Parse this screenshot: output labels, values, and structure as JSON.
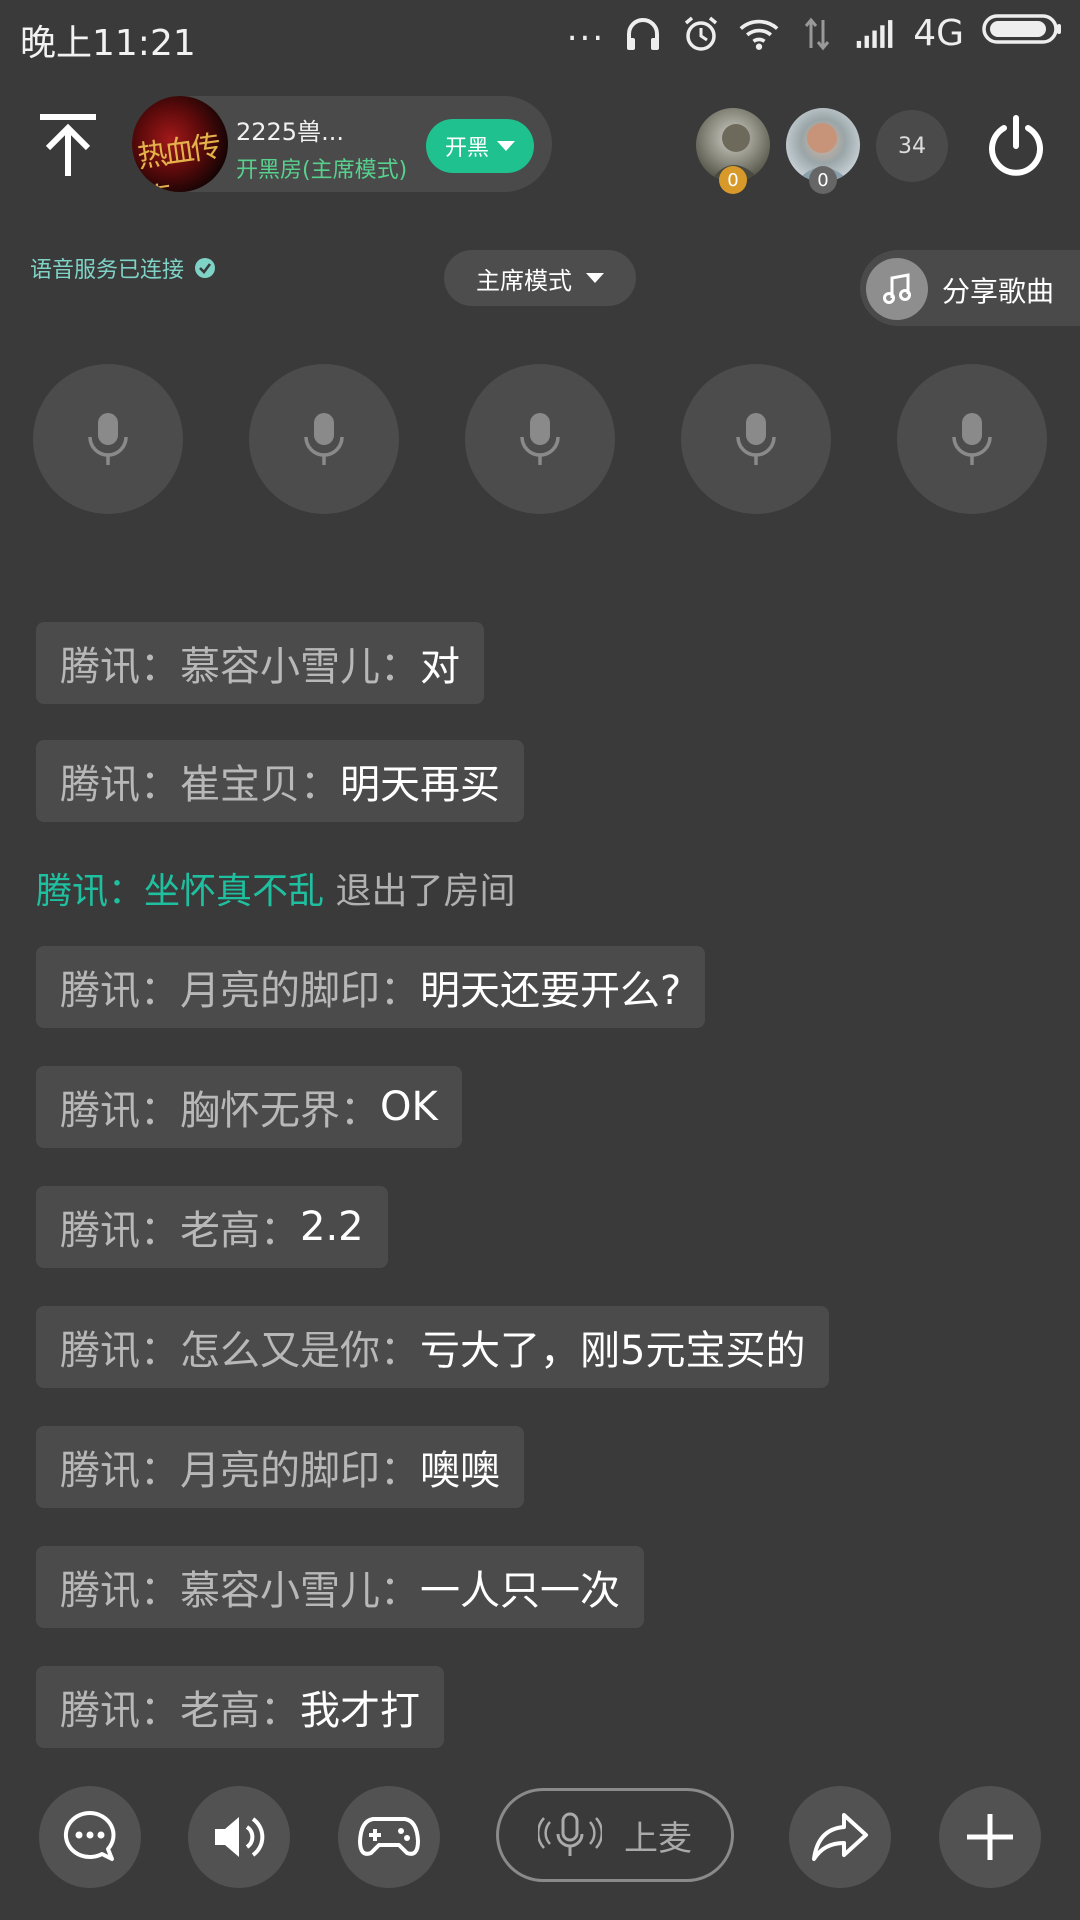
{
  "status_bar": {
    "time": "晚上11:21",
    "more": "...",
    "network": "4G"
  },
  "room": {
    "name": "2225兽...",
    "mode_text": "开黑房(主席模式)",
    "kaihei_label": "开黑",
    "users": [
      {
        "badge": "0",
        "badge_color": "#d79a2a"
      },
      {
        "badge": "0",
        "badge_color": "#666666"
      }
    ],
    "member_count": "34"
  },
  "voice_status": "语音服务已连接",
  "mode_dropdown": "主席模式",
  "share_song_label": "分享歌曲",
  "mic_slots": 5,
  "chat": [
    {
      "prefix": "腾讯：慕容小雪儿：",
      "msg": "对"
    },
    {
      "prefix": "腾讯：崔宝贝：",
      "msg": "明天再买"
    },
    {
      "prefix": "腾讯：月亮的脚印：",
      "msg": "明天还要开么?"
    },
    {
      "prefix": "腾讯：胸怀无界：",
      "msg": "OK"
    },
    {
      "prefix": "腾讯：老高：",
      "msg": "2.2"
    },
    {
      "prefix": "腾讯：怎么又是你：",
      "msg": "亏大了，刚5元宝买的"
    },
    {
      "prefix": "腾讯：月亮的脚印：",
      "msg": "噢噢"
    },
    {
      "prefix": "腾讯：慕容小雪儿：",
      "msg": "一人只一次"
    },
    {
      "prefix": "腾讯：老高：",
      "msg": "我才打"
    }
  ],
  "system_message": {
    "name": "腾讯：坐怀真不乱",
    "text": " 退出了房间"
  },
  "bottom_bar": {
    "mic_up_label": "上麦"
  },
  "colors": {
    "background": "#3a3a3a",
    "accent_green": "#1fc28f",
    "system_name": "#1fc0a0"
  }
}
